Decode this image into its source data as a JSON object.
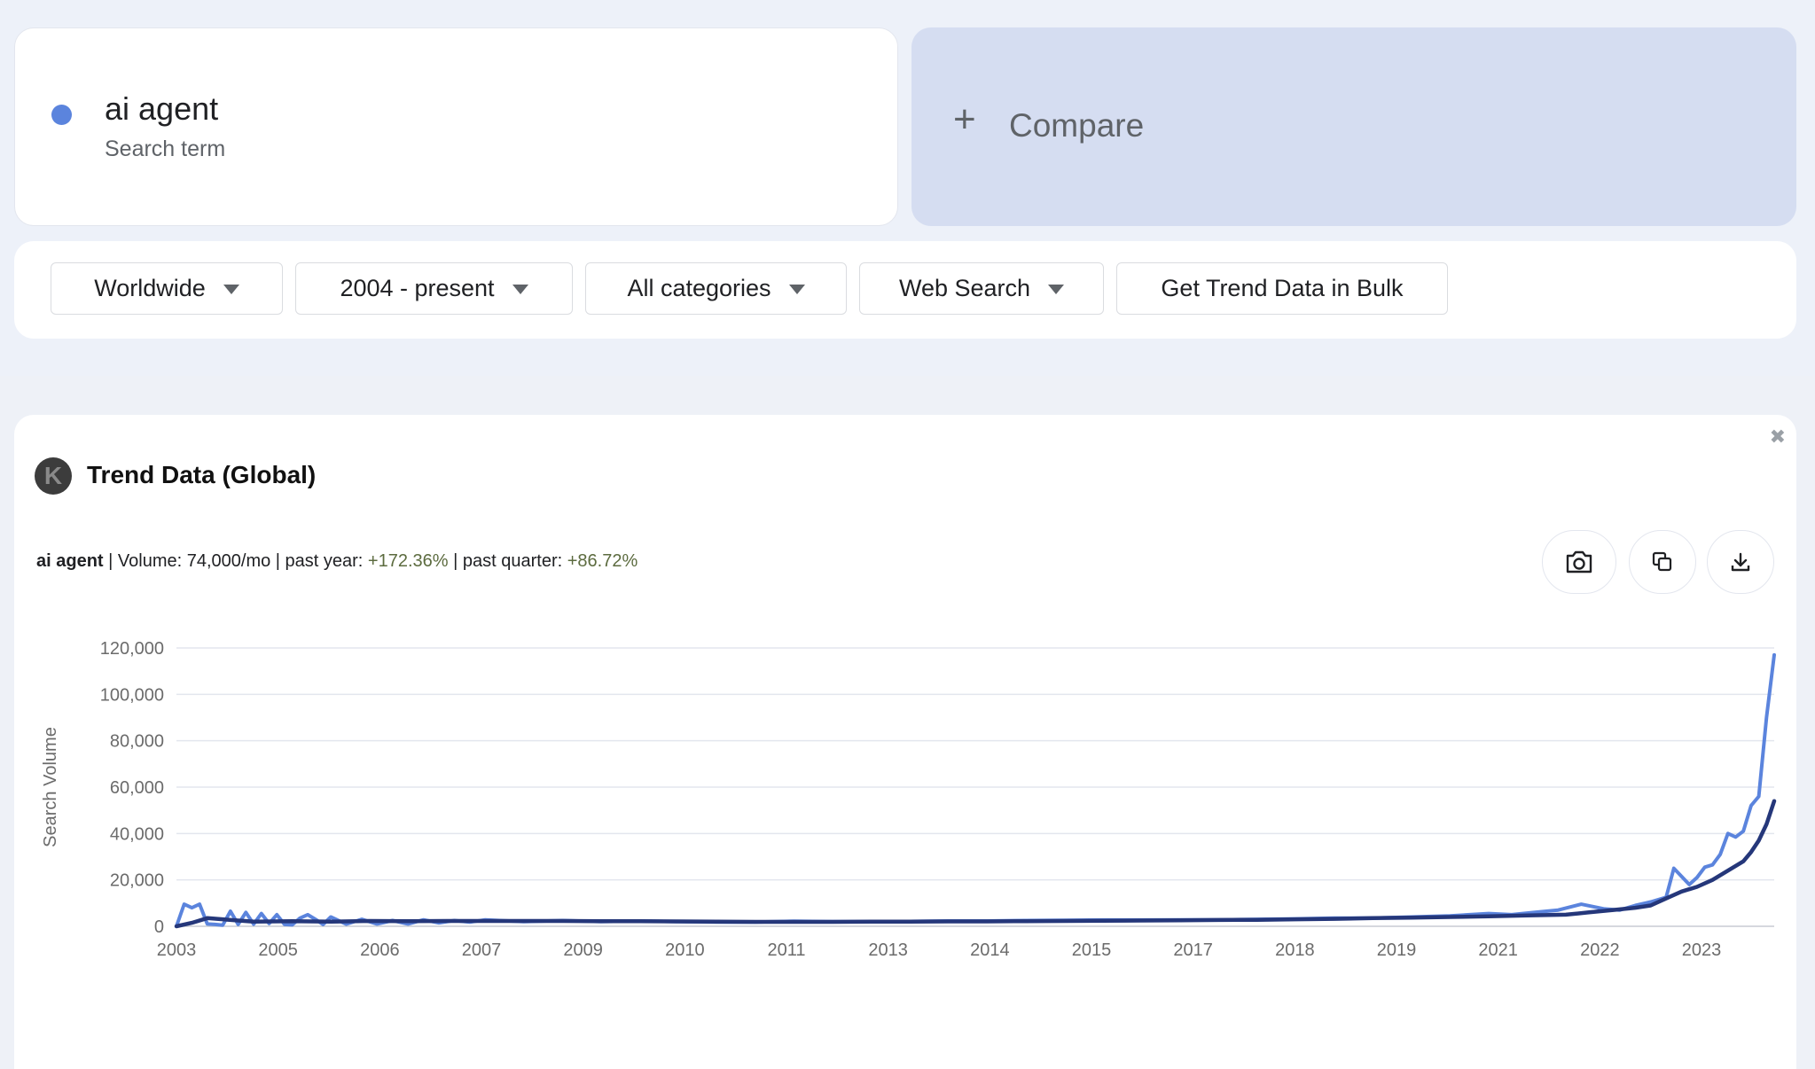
{
  "search_term": {
    "name": "ai agent",
    "subtitle": "Search term",
    "color": "#5b84dd"
  },
  "compare": {
    "label": "Compare"
  },
  "filters": {
    "location": "Worldwide",
    "time_range": "2004 - present",
    "category": "All categories",
    "search_type": "Web Search",
    "bulk_label": "Get Trend Data in Bulk"
  },
  "trend_panel": {
    "title": "Trend Data (Global)",
    "logo_letter": "K",
    "close_icon": "close-icon",
    "stats": {
      "term": "ai agent",
      "volume_label": " | Volume: 74,000/mo | past year: ",
      "past_year": "+172.36%",
      "past_quarter_label": " | past quarter: ",
      "past_quarter": "+86.72%"
    },
    "actions": [
      "camera-icon",
      "copy-icon",
      "download-icon"
    ]
  },
  "chart_data": {
    "type": "line",
    "ylabel": "Search Volume",
    "ylim": [
      0,
      120000
    ],
    "y_ticks": [
      "0",
      "20,000",
      "40,000",
      "60,000",
      "80,000",
      "100,000",
      "120,000"
    ],
    "x_ticks": [
      "2003",
      "2005",
      "2006",
      "2007",
      "2009",
      "2010",
      "2011",
      "2013",
      "2014",
      "2015",
      "2017",
      "2018",
      "2019",
      "2021",
      "2022",
      "2023"
    ],
    "xlim": [
      2003.0,
      2023.7
    ],
    "grid": true,
    "series": [
      {
        "color": "#5b84dd",
        "x": [
          2003.0,
          2003.1,
          2003.2,
          2003.3,
          2003.4,
          2003.5,
          2003.6,
          2003.7,
          2003.8,
          2003.9,
          2004.0,
          2004.1,
          2004.2,
          2004.3,
          2004.4,
          2004.5,
          2004.6,
          2004.7,
          2004.8,
          2004.9,
          2005.0,
          2005.2,
          2005.4,
          2005.6,
          2005.8,
          2006.0,
          2006.2,
          2006.4,
          2006.6,
          2006.8,
          2007.0,
          2007.5,
          2008.0,
          2008.5,
          2009.0,
          2009.5,
          2010.0,
          2010.5,
          2011.0,
          2011.5,
          2012.0,
          2012.5,
          2013.0,
          2013.5,
          2014.0,
          2014.5,
          2015.0,
          2015.5,
          2016.0,
          2016.5,
          2017.0,
          2017.5,
          2018.0,
          2018.5,
          2019.0,
          2019.5,
          2020.0,
          2020.3,
          2020.6,
          2020.9,
          2021.2,
          2021.5,
          2021.7,
          2021.9,
          2022.1,
          2022.3,
          2022.4,
          2022.5,
          2022.6,
          2022.7,
          2022.8,
          2022.9,
          2023.0,
          2023.1,
          2023.2,
          2023.3,
          2023.4,
          2023.5,
          2023.6,
          2023.7
        ],
        "values": [
          0,
          9500,
          8000,
          9500,
          1000,
          800,
          500,
          6500,
          800,
          6000,
          900,
          5500,
          1200,
          5000,
          800,
          600,
          3500,
          5000,
          3000,
          800,
          4000,
          900,
          3000,
          1000,
          2500,
          1000,
          2800,
          1500,
          2500,
          1800,
          2800,
          2000,
          2500,
          2000,
          2300,
          2000,
          1800,
          1800,
          2200,
          2000,
          2000,
          2100,
          2300,
          2300,
          2500,
          2600,
          2700,
          2700,
          2800,
          2800,
          3000,
          3200,
          3500,
          3500,
          4000,
          4500,
          5500,
          5000,
          6000,
          7000,
          9500,
          7500,
          7000,
          9000,
          10500,
          12500,
          25000,
          21500,
          18000,
          21000,
          25500,
          26500,
          31000,
          40000,
          38500,
          41000,
          52000,
          56000,
          90000,
          117000
        ]
      },
      {
        "color": "#25377a",
        "x": [
          2003.0,
          2003.2,
          2003.4,
          2003.6,
          2003.8,
          2004.0,
          2004.5,
          2005.0,
          2005.5,
          2006.0,
          2006.5,
          2007.0,
          2007.5,
          2008.0,
          2008.5,
          2009.0,
          2009.5,
          2010.0,
          2010.5,
          2011.0,
          2011.5,
          2012.0,
          2012.5,
          2013.0,
          2013.5,
          2014.0,
          2014.5,
          2015.0,
          2015.5,
          2016.0,
          2016.5,
          2017.0,
          2017.5,
          2018.0,
          2018.5,
          2019.0,
          2019.5,
          2020.0,
          2020.5,
          2021.0,
          2021.3,
          2021.6,
          2021.9,
          2022.1,
          2022.3,
          2022.5,
          2022.7,
          2022.9,
          2023.1,
          2023.3,
          2023.4,
          2023.5,
          2023.6,
          2023.7
        ],
        "values": [
          0,
          1500,
          3500,
          3000,
          2500,
          2000,
          2200,
          2000,
          2300,
          2200,
          2300,
          2300,
          2300,
          2300,
          2200,
          2200,
          2100,
          2000,
          1900,
          1900,
          1900,
          2000,
          2000,
          2100,
          2100,
          2200,
          2300,
          2400,
          2500,
          2600,
          2700,
          2800,
          3000,
          3200,
          3500,
          3700,
          4000,
          4300,
          4700,
          5000,
          6000,
          7000,
          8000,
          9000,
          12000,
          15000,
          17000,
          20000,
          24000,
          28000,
          32000,
          37000,
          44000,
          54000
        ]
      }
    ]
  }
}
